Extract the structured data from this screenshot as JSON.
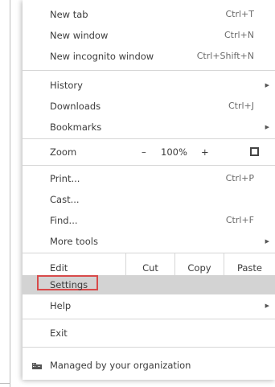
{
  "menu": {
    "new_tab": {
      "label": "New tab",
      "shortcut": "Ctrl+T"
    },
    "new_window": {
      "label": "New window",
      "shortcut": "Ctrl+N"
    },
    "new_incognito": {
      "label": "New incognito window",
      "shortcut": "Ctrl+Shift+N"
    },
    "history": {
      "label": "History"
    },
    "downloads": {
      "label": "Downloads",
      "shortcut": "Ctrl+J"
    },
    "bookmarks": {
      "label": "Bookmarks"
    },
    "zoom": {
      "label": "Zoom",
      "minus": "–",
      "value": "100%",
      "plus": "+"
    },
    "print": {
      "label": "Print...",
      "shortcut": "Ctrl+P"
    },
    "cast": {
      "label": "Cast..."
    },
    "find": {
      "label": "Find...",
      "shortcut": "Ctrl+F"
    },
    "more_tools": {
      "label": "More tools"
    },
    "edit": {
      "label": "Edit",
      "cut": "Cut",
      "copy": "Copy",
      "paste": "Paste"
    },
    "settings": {
      "label": "Settings"
    },
    "help": {
      "label": "Help"
    },
    "exit": {
      "label": "Exit"
    },
    "managed": {
      "label": "Managed by your organization"
    }
  },
  "colors": {
    "highlight": "#d3d3d3",
    "annotation_box": "#d84a4a"
  },
  "icons": {
    "submenu": "chevron-right-icon",
    "fullscreen": "fullscreen-icon",
    "managed": "building-icon"
  }
}
